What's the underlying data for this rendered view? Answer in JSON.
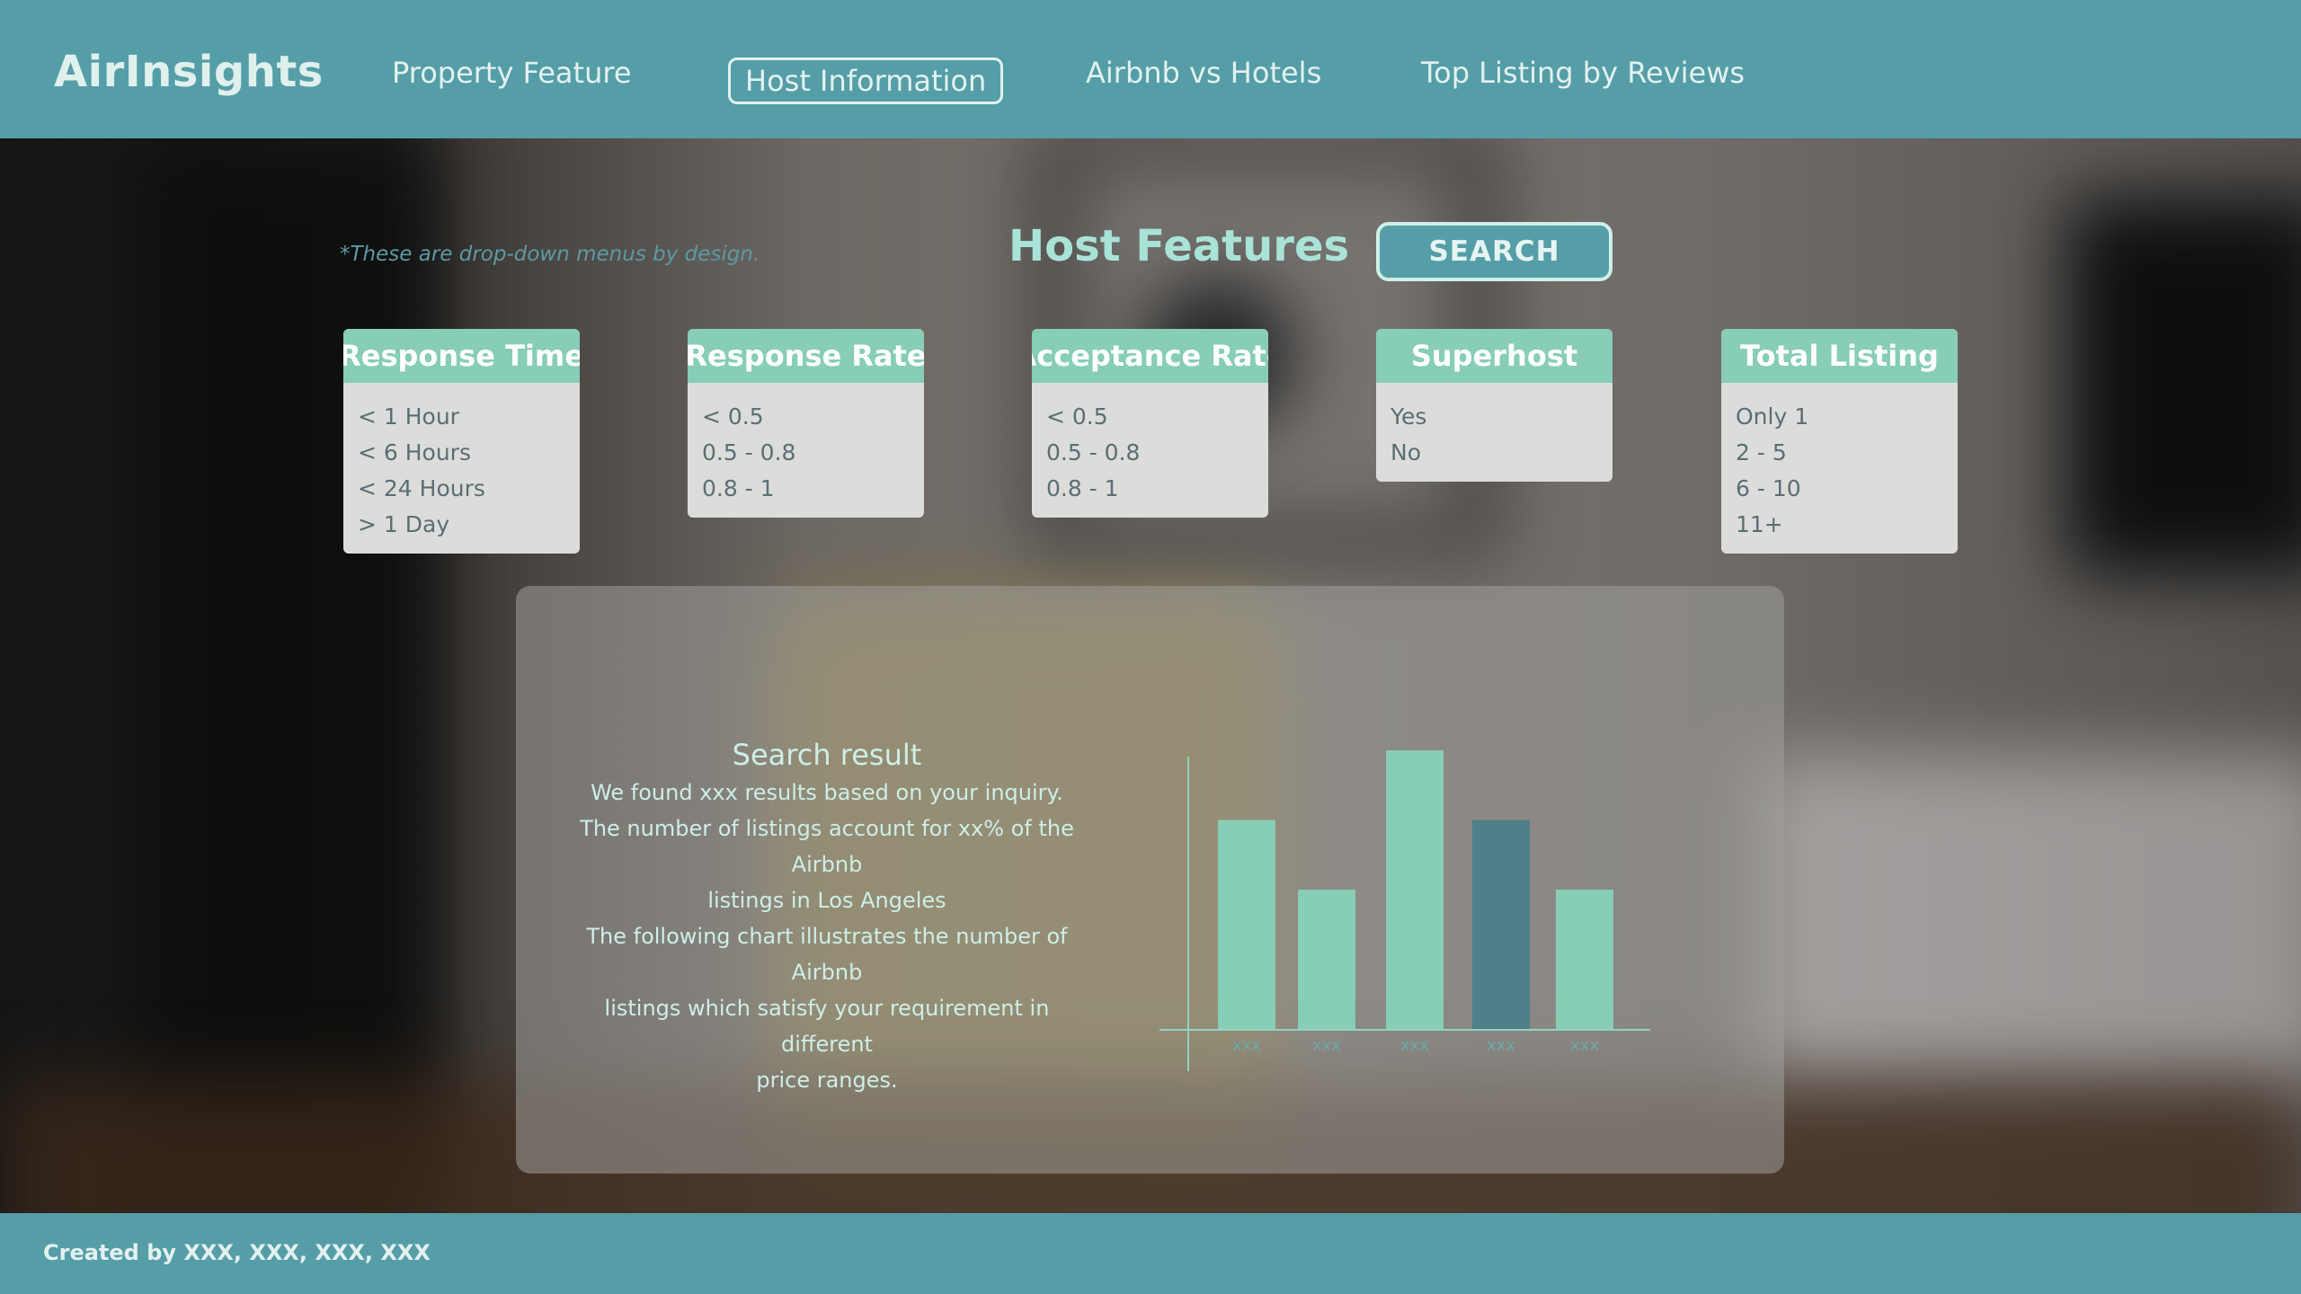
{
  "app": {
    "title": "AirInsights"
  },
  "nav": {
    "items": [
      {
        "label": "Property Feature",
        "active": false
      },
      {
        "label": "Host Information",
        "active": true
      },
      {
        "label": "Airbnb vs Hotels",
        "active": false
      },
      {
        "label": "Top Listing by Reviews",
        "active": false
      }
    ]
  },
  "page": {
    "note": "*These are drop-down menus by design.",
    "title": "Host Features",
    "search_label": "SEARCH"
  },
  "filters": [
    {
      "title": "Response Time",
      "options": [
        "< 1 Hour",
        "< 6 Hours",
        "< 24 Hours",
        "> 1 Day"
      ]
    },
    {
      "title": "Response Rate",
      "options": [
        "< 0.5",
        "0.5 - 0.8",
        "0.8 - 1"
      ]
    },
    {
      "title": "Acceptance Rate",
      "options": [
        "< 0.5",
        "0.5 - 0.8",
        "0.8 - 1"
      ]
    },
    {
      "title": "Superhost",
      "options": [
        "Yes",
        "No"
      ]
    },
    {
      "title": "Total Listing",
      "options": [
        "Only 1",
        "2 - 5",
        "6 - 10",
        "11+"
      ]
    }
  ],
  "result": {
    "title": "Search result",
    "lines": [
      "We found xxx results based on your inquiry.",
      "The number of listings account for xx% of the Airbnb",
      "listings in Los Angeles",
      "The following chart illustrates the number of Airbnb",
      "listings which satisfy your requirement in different",
      "price ranges."
    ]
  },
  "chart_data": {
    "type": "bar",
    "categories": [
      "xxx",
      "xxx",
      "xxx",
      "xxx",
      "xxx"
    ],
    "values": [
      3.0,
      2.0,
      4.0,
      3.0,
      2.0
    ],
    "highlight_index": 3,
    "ylim": [
      0,
      4
    ],
    "colors": {
      "bar": "#88cdb6",
      "highlight": "#4f7f89",
      "axis": "#8fd3c2"
    }
  },
  "footer": {
    "credit": "Created by XXX, XXX, XXX, XXX"
  },
  "colors": {
    "header": "#559ea8",
    "accent": "#87cdb8",
    "title": "#a9e3d7"
  }
}
